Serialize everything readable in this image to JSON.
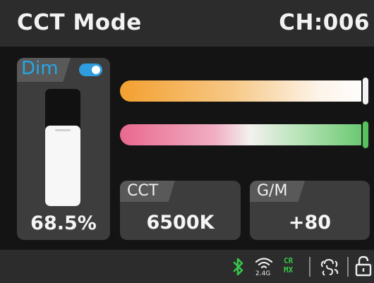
{
  "header": {
    "mode_title": "CCT Mode",
    "channel": "CH:006"
  },
  "dim": {
    "label": "Dim",
    "toggle_on": true,
    "level_percent": 68.5,
    "value_text": "68.5%"
  },
  "sliders": {
    "cct_level": 1.0,
    "gm_level": 1.0
  },
  "cards": {
    "cct_label": "CCT",
    "cct_value": "6500K",
    "gm_label": "G/M",
    "gm_value": "+80"
  },
  "status": {
    "wireless_band": "2.4G",
    "crmx_line1": "CR",
    "crmx_line2": "MX",
    "icons": [
      "bluetooth-icon",
      "wireless-icon",
      "crmx-icon",
      "link-icon",
      "unlock-icon"
    ]
  },
  "colors": {
    "accent_blue": "#25a7e8",
    "status_green": "#39c44a",
    "header_bg": "#2c2c2c",
    "panel_bg": "#3d3d3d"
  }
}
